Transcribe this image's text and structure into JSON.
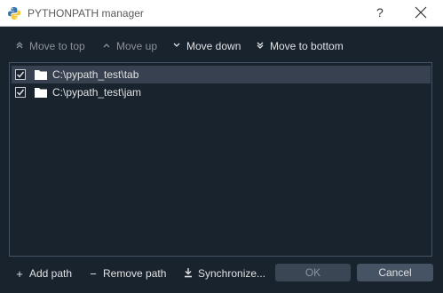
{
  "window": {
    "title": "PYTHONPATH manager",
    "help_glyph": "?"
  },
  "toolbar": {
    "move_to_top": "Move to top",
    "move_up": "Move up",
    "move_down": "Move down",
    "move_to_bottom": "Move to bottom"
  },
  "paths": [
    {
      "label": "C:\\pypath_test\\tab",
      "checked": true,
      "selected": true
    },
    {
      "label": "C:\\pypath_test\\jam",
      "checked": true,
      "selected": false
    }
  ],
  "actions": {
    "add_path": "Add path",
    "remove_path": "Remove path",
    "synchronize": "Synchronize...",
    "ok": "OK",
    "cancel": "Cancel"
  },
  "colors": {
    "background": "#19232d",
    "selection": "#37414f",
    "button": "#455364",
    "border": "#455364"
  }
}
